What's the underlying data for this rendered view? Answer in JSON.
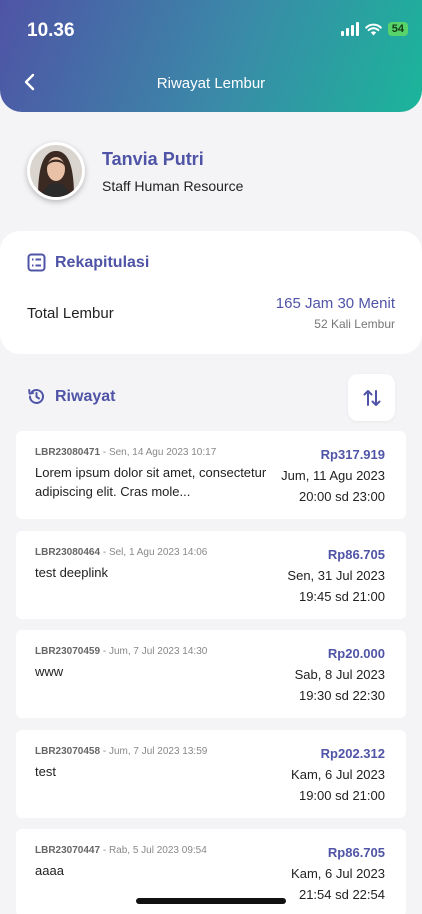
{
  "status_bar": {
    "time": "10.36",
    "battery": "54"
  },
  "header": {
    "title": "Riwayat Lembur"
  },
  "profile": {
    "name": "Tanvia Putri",
    "role": "Staff Human Resource"
  },
  "rekap": {
    "heading": "Rekapitulasi",
    "total_label": "Total Lembur",
    "total_hours": "165 Jam 30 Menit",
    "total_count": "52 Kali Lembur"
  },
  "riwayat": {
    "heading": "Riwayat"
  },
  "items": [
    {
      "code": "LBR23080471",
      "created": "Sen, 14 Agu 2023 10:17",
      "description": "Lorem ipsum dolor sit amet, consectetur adipiscing elit. Cras mole...",
      "amount": "Rp317.919",
      "date": "Jum, 11 Agu 2023",
      "time": "20:00 sd 23:00"
    },
    {
      "code": "LBR23080464",
      "created": "Sel, 1 Agu 2023 14:06",
      "description": "test deeplink",
      "amount": "Rp86.705",
      "date": "Sen, 31 Jul 2023",
      "time": "19:45 sd 21:00"
    },
    {
      "code": "LBR23070459",
      "created": "Jum, 7 Jul 2023 14:30",
      "description": "www",
      "amount": "Rp20.000",
      "date": "Sab, 8 Jul 2023",
      "time": "19:30 sd 22:30"
    },
    {
      "code": "LBR23070458",
      "created": "Jum, 7 Jul 2023 13:59",
      "description": "test",
      "amount": "Rp202.312",
      "date": "Kam, 6 Jul 2023",
      "time": "19:00 sd 21:00"
    },
    {
      "code": "LBR23070447",
      "created": "Rab, 5 Jul 2023 09:54",
      "description": "aaaa",
      "amount": "Rp86.705",
      "date": "Kam, 6 Jul 2023",
      "time": "21:54 sd 22:54"
    }
  ],
  "colors": {
    "accent": "#4f54a6",
    "gradient_end": "#1bb59a",
    "background": "#f4f4f6"
  }
}
